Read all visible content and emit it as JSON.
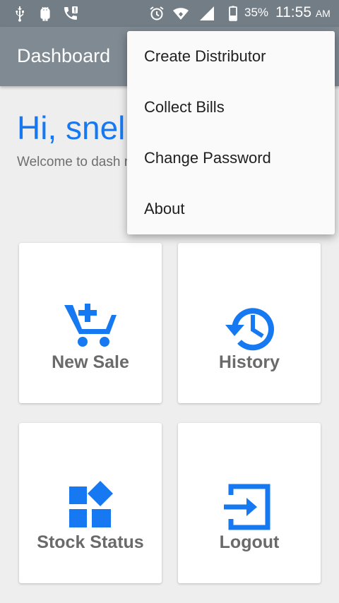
{
  "status_bar": {
    "battery_percent": "35%",
    "time": "11:55",
    "ampm": "AM",
    "icons": [
      "usb-icon",
      "android-debug-icon",
      "call-alert-icon",
      "alarm-icon",
      "wifi-icon",
      "signal-icon",
      "battery-icon"
    ]
  },
  "app_bar": {
    "title": "Dashboard"
  },
  "greeting": {
    "text": "Hi, snel",
    "welcome": "Welcome to dash manage your Sto sale."
  },
  "tiles": {
    "new_sale": "New Sale",
    "history": "History",
    "stock_status": "Stock Status",
    "logout": "Logout"
  },
  "menu": {
    "items": [
      "Create Distributor",
      "Collect Bills",
      "Change Password",
      "About"
    ]
  },
  "colors": {
    "accent": "#1679f2",
    "app_bar": "#7f8a93",
    "status_bar": "#737d86"
  }
}
